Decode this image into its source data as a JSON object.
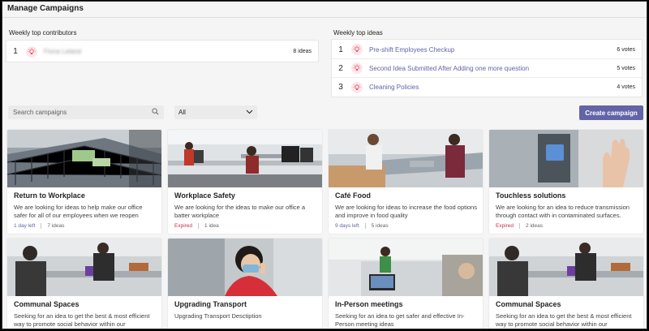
{
  "page": {
    "title": "Manage Campaigns"
  },
  "contributors": {
    "heading": "Weekly top contributors",
    "items": [
      {
        "rank": "1",
        "name": "Fiona Leland",
        "count": "8 ideas"
      }
    ]
  },
  "top_ideas": {
    "heading": "Weekly top ideas",
    "items": [
      {
        "rank": "1",
        "title": "Pre-shift Employees Checkup",
        "votes": "6 votes"
      },
      {
        "rank": "2",
        "title": "Second Idea Submitted After Adding one more question",
        "votes": "5 votes"
      },
      {
        "rank": "3",
        "title": "Cleaning Policies",
        "votes": "4 votes"
      }
    ]
  },
  "toolbar": {
    "search_placeholder": "Search campaigns",
    "filter_value": "All",
    "create_label": "Create campaign"
  },
  "campaigns": [
    {
      "title": "Return to Workplace",
      "description": "We are looking for ideas to help make our office safer for all of our employees when we reopen",
      "status": "1 day left",
      "ideas": "7 ideas"
    },
    {
      "title": "Workplace Safety",
      "description": "We are looking for the ideas to make our office a batter workplace",
      "status": "Expired",
      "ideas": "1 idea"
    },
    {
      "title": "Café Food",
      "description": "We are looking for ideas to increase the food options and improve in food quality",
      "status": "9 days left",
      "ideas": "5 ideas"
    },
    {
      "title": "Touchless solutions",
      "description": "We are looking for an idea to reduce transmission through contact with in contaminated surfaces.",
      "status": "Expired",
      "ideas": "2 ideas"
    },
    {
      "title": "Communal Spaces",
      "description": "Seeking for an idea to get the best & most efficient way to promote social behavior within our"
    },
    {
      "title": "Upgrading Transport",
      "description": "Upgrading Transport  Desctiption"
    },
    {
      "title": "In-Person meetings",
      "description": "Seeking for an idea to get safer and effective In-Person meeting ideas"
    },
    {
      "title": "Communal Spaces",
      "description": "Seeking for an idea to get the best & most efficient way to promote social behavior within our"
    }
  ],
  "colors": {
    "accent": "#6264a7",
    "expired": "#c4314b",
    "bulb": "#e8516a"
  },
  "icons": {
    "bulb": "lightbulb-icon",
    "search": "search-icon",
    "dropdown": "chevron-down-icon"
  }
}
